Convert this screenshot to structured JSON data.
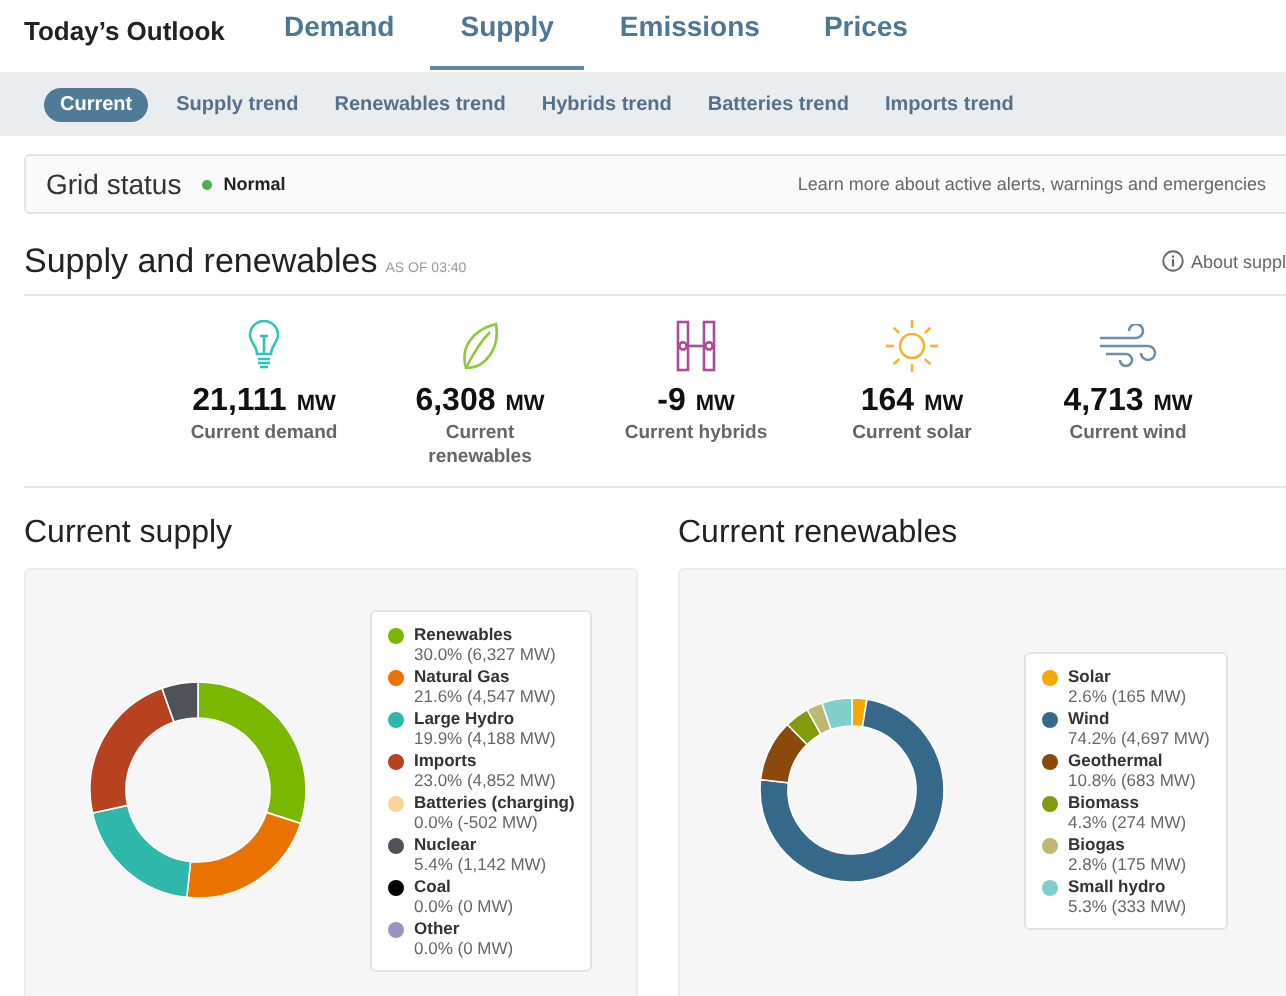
{
  "header": {
    "title": "Today’s Outlook"
  },
  "tabs": [
    {
      "label": "Demand",
      "selected": false
    },
    {
      "label": "Supply",
      "selected": true
    },
    {
      "label": "Emissions",
      "selected": false
    },
    {
      "label": "Prices",
      "selected": false
    }
  ],
  "subtabs": [
    {
      "label": "Current",
      "selected": true
    },
    {
      "label": "Supply trend",
      "selected": false
    },
    {
      "label": "Renewables trend",
      "selected": false
    },
    {
      "label": "Hybrids trend",
      "selected": false
    },
    {
      "label": "Batteries trend",
      "selected": false
    },
    {
      "label": "Imports trend",
      "selected": false
    }
  ],
  "grid_status": {
    "label": "Grid status",
    "value": "Normal",
    "color": "#4caf50",
    "link": "Learn more about active alerts, warnings and emergencies"
  },
  "section": {
    "title": "Supply and renewables",
    "timestamp": "AS OF 03:40",
    "about": "About suppl"
  },
  "stats": [
    {
      "kind": "bulb",
      "value": "21,111",
      "unit": "MW",
      "label": "Current demand"
    },
    {
      "kind": "leaf",
      "value": "6,308",
      "unit": "MW",
      "label": "Current renewables"
    },
    {
      "kind": "hybrid",
      "value": "-9",
      "unit": "MW",
      "label": "Current hybrids"
    },
    {
      "kind": "sun",
      "value": "164",
      "unit": "MW",
      "label": "Current solar"
    },
    {
      "kind": "wind",
      "value": "4,713",
      "unit": "MW",
      "label": "Current wind"
    }
  ],
  "panels": [
    {
      "title": "Current supply",
      "legend": [
        {
          "detail": "30.0% (6,327 MW)",
          "color": "#7ab800"
        },
        {
          "detail": "21.6% (4,547 MW)",
          "color": "#ec7200"
        },
        {
          "detail": "19.9% (4,188 MW)",
          "color": "#2fb7ab"
        },
        {
          "detail": "23.0% (4,852 MW)",
          "color": "#b8411f"
        },
        {
          "detail": "0.0% (-502 MW)",
          "color": "#f9d49b"
        },
        {
          "detail": "5.4% (1,142 MW)",
          "color": "#4f5257"
        },
        {
          "detail": "0.0% (0 MW)",
          "color": "#000000"
        },
        {
          "detail": "0.0% (0 MW)",
          "color": "#9a95c0"
        }
      ],
      "chart_data": {
        "type": "donut",
        "categories": [
          "Renewables",
          "Natural Gas",
          "Large Hydro",
          "Imports",
          "Batteries (charging)",
          "Nuclear",
          "Coal",
          "Other"
        ],
        "values": [
          30.0,
          21.6,
          19.9,
          23.0,
          0.0,
          5.4,
          0.0,
          0.0
        ]
      }
    },
    {
      "title": "Current renewables",
      "legend": [
        {
          "detail": "2.6% (165 MW)",
          "color": "#f6a800"
        },
        {
          "detail": "74.2% (4,697 MW)",
          "color": "#36688a"
        },
        {
          "detail": "10.8% (683 MW)",
          "color": "#8b4a0c"
        },
        {
          "detail": "4.3% (274 MW)",
          "color": "#829a0e"
        },
        {
          "detail": "2.8% (175 MW)",
          "color": "#bdb772"
        },
        {
          "detail": "5.3% (333 MW)",
          "color": "#7fd0cc"
        }
      ],
      "chart_data": {
        "type": "donut",
        "categories": [
          "Solar",
          "Wind",
          "Geothermal",
          "Biomass",
          "Biogas",
          "Small hydro"
        ],
        "values": [
          2.6,
          74.2,
          10.8,
          4.3,
          2.8,
          5.3
        ]
      }
    }
  ]
}
